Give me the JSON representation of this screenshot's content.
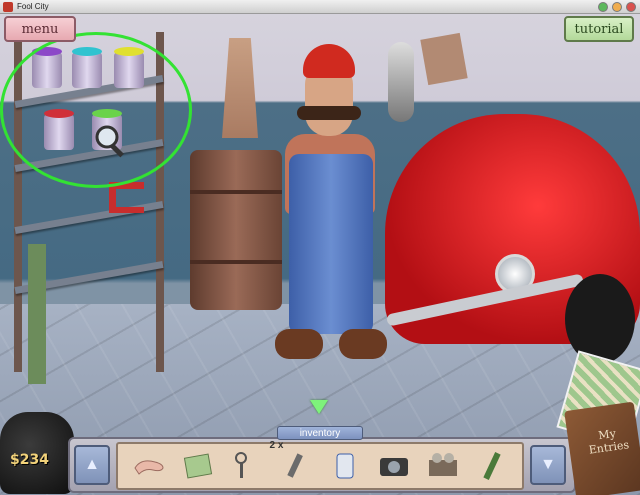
{
  "window": {
    "title": "Fool City"
  },
  "top_bar": {
    "menu_label": "menu",
    "tutorial_label": "tutorial"
  },
  "hud": {
    "money": "$234",
    "diary_label": "My Entries",
    "inventory_label": "inventory",
    "item_count": "2 x",
    "items": [
      {
        "name": "bone-icon"
      },
      {
        "name": "map-fragment-icon"
      },
      {
        "name": "keys-icon"
      },
      {
        "name": "wrench-icon"
      },
      {
        "name": "can-icon"
      },
      {
        "name": "camera-icon"
      },
      {
        "name": "tape-recorder-icon"
      },
      {
        "name": "marker-icon"
      }
    ]
  },
  "highlight_color": "#33e233"
}
